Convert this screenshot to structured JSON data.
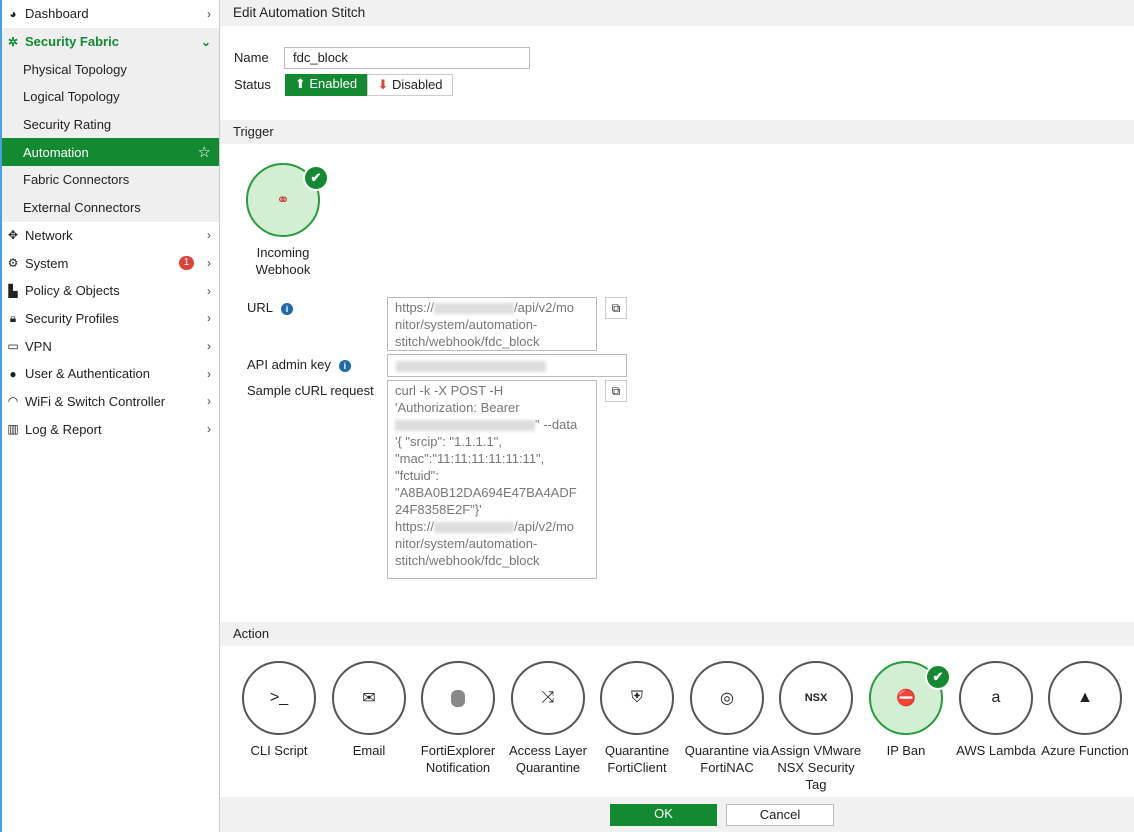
{
  "sidebar": {
    "items": [
      {
        "label": "Dashboard",
        "icon": "dashboard-icon"
      },
      {
        "label": "Security Fabric",
        "icon": "fabric-icon"
      },
      {
        "label": "Physical Topology"
      },
      {
        "label": "Logical Topology"
      },
      {
        "label": "Security Rating"
      },
      {
        "label": "Automation"
      },
      {
        "label": "Fabric Connectors"
      },
      {
        "label": "External Connectors"
      },
      {
        "label": "Network",
        "icon": "network-icon"
      },
      {
        "label": "System",
        "icon": "gear-icon",
        "badge": "1"
      },
      {
        "label": "Policy & Objects",
        "icon": "policy-icon"
      },
      {
        "label": "Security Profiles",
        "icon": "lock-icon"
      },
      {
        "label": "VPN",
        "icon": "laptop-icon"
      },
      {
        "label": "User & Authentication",
        "icon": "user-icon"
      },
      {
        "label": "WiFi & Switch Controller",
        "icon": "wifi-icon"
      },
      {
        "label": "Log & Report",
        "icon": "chart-icon"
      }
    ]
  },
  "header": {
    "title": "Edit Automation Stitch"
  },
  "form": {
    "name_label": "Name",
    "name_value": "fdc_block",
    "status_label": "Status",
    "enabled": "Enabled",
    "disabled": "Disabled"
  },
  "trigger": {
    "title": "Trigger",
    "name1": "Incoming",
    "name2": "Webhook",
    "url_label": "URL",
    "url_prefix": "https://",
    "url_suffix": "/api/v2/mo",
    "url_rest": "nitor/system/automation-\nstitch/webhook/fdc_block",
    "key_label": "API admin key",
    "curl_label": "Sample cURL request",
    "curl_1": "curl -k -X POST -H\n'Authorization: Bearer\n",
    "curl_2": "\" --data",
    "curl_3": "\n'{ \"srcip\": \"1.1.1.1\",\n\"mac\":\"11:11:11:11:11:11\",\n\"fctuid\":\n\"A8BA0B12DA694E47BA4ADF\n24F8358E2F\"}'\nhttps://",
    "curl_4": "/api/v2/mo\nnitor/system/automation-\nstitch/webhook/fdc_block"
  },
  "action": {
    "title": "Action",
    "items": [
      {
        "label": "CLI Script",
        "glyph": ">_"
      },
      {
        "label": "Email",
        "glyph": "✉"
      },
      {
        "label": "FortiExplorer Notification",
        "glyph": ""
      },
      {
        "label": "Access Layer Quarantine",
        "glyph": "⤨"
      },
      {
        "label": "Quarantine FortiClient",
        "glyph": "⛨"
      },
      {
        "label": "Quarantine via FortiNAC",
        "glyph": "◎"
      },
      {
        "label": "Assign VMware NSX Security Tag",
        "glyph": "NSX"
      },
      {
        "label": "IP Ban",
        "glyph": "⛔"
      },
      {
        "label": "AWS Lambda",
        "glyph": "a"
      },
      {
        "label": "Azure Function",
        "glyph": "▲"
      }
    ]
  },
  "footer": {
    "ok": "OK",
    "cancel": "Cancel"
  },
  "colors": {
    "accent": "#138a32",
    "danger": "#d9453d"
  }
}
